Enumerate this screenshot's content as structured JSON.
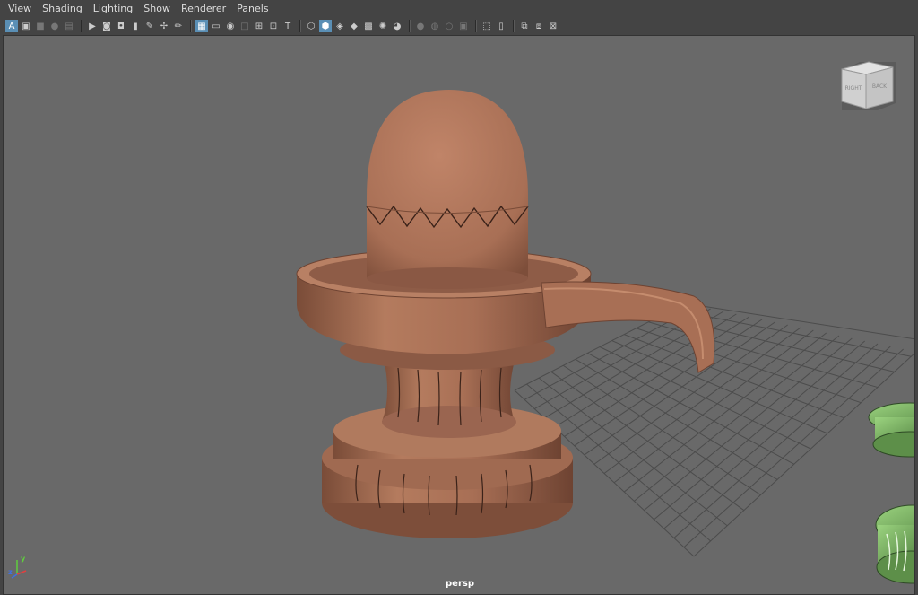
{
  "menu": [
    "View",
    "Shading",
    "Lighting",
    "Show",
    "Renderer",
    "Panels"
  ],
  "toolbar": [
    {
      "icon": "select-camera-icon",
      "glyph": "A",
      "state": "active"
    },
    {
      "icon": "frame-icon",
      "glyph": "▣",
      "state": "normal"
    },
    {
      "icon": "bookmark-icon",
      "glyph": "■",
      "state": "dim"
    },
    {
      "icon": "image-plane-icon",
      "glyph": "●",
      "state": "dim"
    },
    {
      "icon": "2d-pan-icon",
      "glyph": "▤",
      "state": "dim"
    },
    {
      "sep": true
    },
    {
      "icon": "camera-icon",
      "glyph": "▶",
      "state": "normal"
    },
    {
      "icon": "camera-lock-icon",
      "glyph": "◙",
      "state": "normal"
    },
    {
      "icon": "camera-attributes-icon",
      "glyph": "◘",
      "state": "normal"
    },
    {
      "icon": "bookmark-flag-icon",
      "glyph": "▮",
      "state": "normal"
    },
    {
      "icon": "grease-pencil-icon",
      "glyph": "✎",
      "state": "normal"
    },
    {
      "icon": "snap-icon",
      "glyph": "✢",
      "state": "normal"
    },
    {
      "icon": "pencil-icon",
      "glyph": "✏",
      "state": "normal"
    },
    {
      "sep": true
    },
    {
      "icon": "grid-icon",
      "glyph": "▦",
      "state": "active"
    },
    {
      "icon": "film-gate-icon",
      "glyph": "▭",
      "state": "normal"
    },
    {
      "icon": "resolution-gate-icon",
      "glyph": "◉",
      "state": "normal"
    },
    {
      "icon": "gate-mask-icon",
      "glyph": "□",
      "state": "dim"
    },
    {
      "icon": "field-chart-icon",
      "glyph": "⊞",
      "state": "normal"
    },
    {
      "icon": "safe-action-icon",
      "glyph": "⊡",
      "state": "normal"
    },
    {
      "icon": "safe-title-icon",
      "glyph": "T",
      "state": "normal"
    },
    {
      "sep": true
    },
    {
      "icon": "wireframe-icon",
      "glyph": "⬡",
      "state": "normal"
    },
    {
      "icon": "smooth-shade-icon",
      "glyph": "⬢",
      "state": "active"
    },
    {
      "icon": "wireframe-on-shaded-icon",
      "glyph": "◈",
      "state": "normal"
    },
    {
      "icon": "textured-icon",
      "glyph": "◆",
      "state": "normal"
    },
    {
      "icon": "checker-icon",
      "glyph": "▩",
      "state": "normal"
    },
    {
      "icon": "lights-icon",
      "glyph": "✺",
      "state": "normal"
    },
    {
      "icon": "shadows-icon",
      "glyph": "◕",
      "state": "normal"
    },
    {
      "sep": true
    },
    {
      "icon": "ambient-occlusion-icon",
      "glyph": "●",
      "state": "dim"
    },
    {
      "icon": "motion-blur-icon",
      "glyph": "◍",
      "state": "dim"
    },
    {
      "icon": "anti-alias-icon",
      "glyph": "○",
      "state": "dim"
    },
    {
      "icon": "depth-of-field-icon",
      "glyph": "▣",
      "state": "dim"
    },
    {
      "sep": true
    },
    {
      "icon": "isolate-select-icon",
      "glyph": "⬚",
      "state": "normal"
    },
    {
      "icon": "xray-icon",
      "glyph": "▯",
      "state": "normal"
    },
    {
      "sep": true
    },
    {
      "icon": "xray-joints-icon",
      "glyph": "⧉",
      "state": "normal"
    },
    {
      "icon": "xray-components-icon",
      "glyph": "⧈",
      "state": "normal"
    },
    {
      "icon": "backface-culling-icon",
      "glyph": "⊠",
      "state": "normal"
    }
  ],
  "viewport": {
    "camera": "persp",
    "viewcube": {
      "right": "RIGHT",
      "back": "BACK"
    },
    "axis": {
      "y": "y",
      "z": "z"
    },
    "colors": {
      "background": "#696969",
      "model": "#b0785c",
      "grid": "#4c4c4c",
      "selected": "#7fbf6b"
    }
  }
}
